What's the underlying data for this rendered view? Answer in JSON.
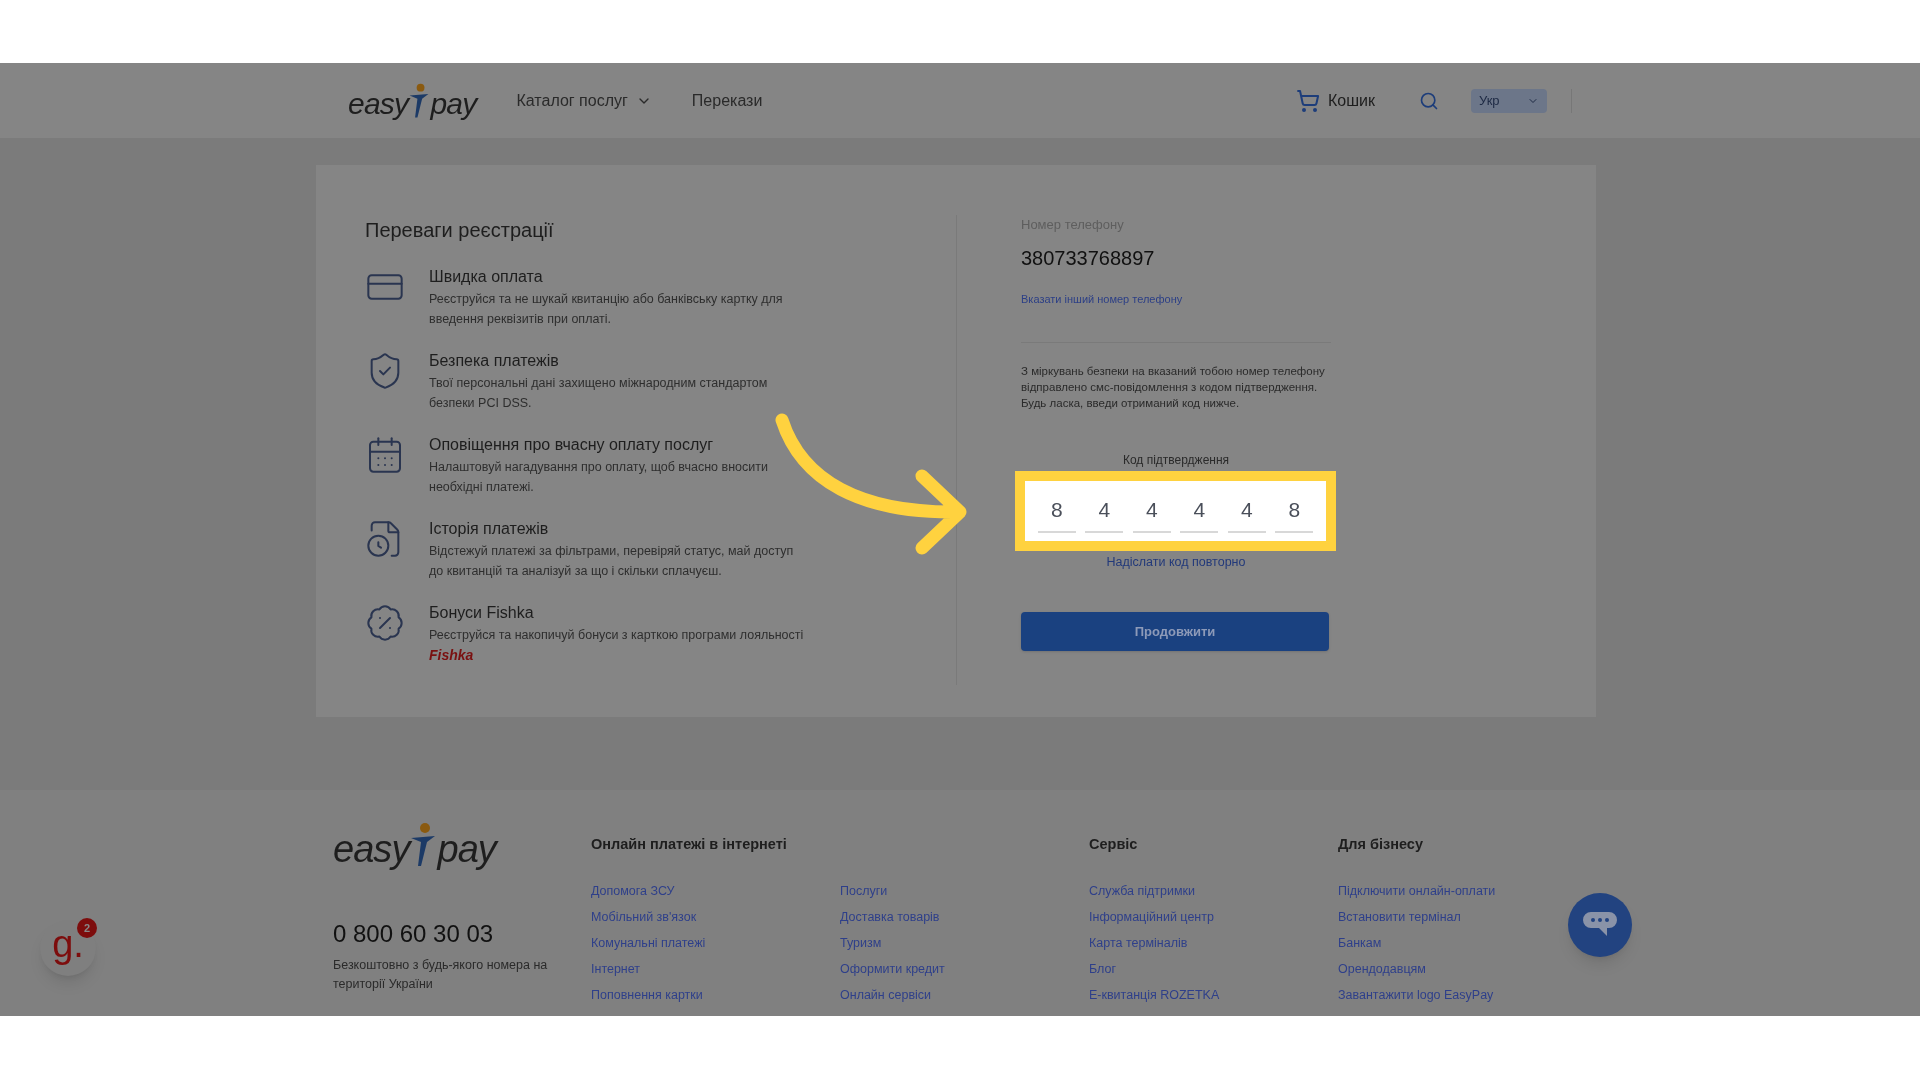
{
  "header": {
    "logo": {
      "left": "easy",
      "right": "pay"
    },
    "nav": [
      {
        "label": "Каталог послуг",
        "kind": "dropdown"
      },
      {
        "label": "Перекази",
        "kind": "link"
      }
    ],
    "cart": "Кошик",
    "language": "Укр"
  },
  "benefits": {
    "title": "Переваги реєстрації",
    "items": [
      {
        "title": "Швидка оплата",
        "text": "Реєструйся та не шукай квитанцію або банківську картку для введення реквізитів при оплаті."
      },
      {
        "title": "Безпека платежів",
        "text": "Твої персональні дані захищено міжнародним стандартом безпеки PCI DSS."
      },
      {
        "title": "Оповіщення про вчасну оплату послуг",
        "text": "Налаштовуй нагадування про оплату, щоб вчасно вносити необхідні платежі."
      },
      {
        "title": "Історія платежів",
        "text": "Відстежуй платежі за фільтрами, перевіряй статус, май доступ до квитанцій та аналізуй за що і скільки сплачуєш."
      },
      {
        "title": "Бонуси Fishka",
        "text": "Реєструйся та накопичуй бонуси з карткою програми лояльності",
        "brand": "Fishka"
      }
    ]
  },
  "form": {
    "phone_label": "Номер телефону",
    "phone": "380733768897",
    "change_link": "Вказати інший номер телефону",
    "notice": "З міркувань безпеки на вказаний тобою номер телефону відправлено смс-повідомлення з кодом підтвердження. Будь ласка, введи отриманий код нижче.",
    "code_label": "Код підтвердження",
    "code_digits": [
      "8",
      "4",
      "4",
      "4",
      "4",
      "8"
    ],
    "resend": "Надіслати код повторно",
    "submit": "Продовжити"
  },
  "footer": {
    "logo": {
      "left": "easy",
      "right": "pay"
    },
    "phone": "0 800 60 30 03",
    "phone_note": "Безкоштовно з будь-якого номера на території України",
    "sections": [
      {
        "heading": "Онлайн платежі в інтернеті",
        "columns": [
          [
            "Допомога ЗСУ",
            "Мобільний зв'язок",
            "Комунальні платежі",
            "Інтернет",
            "Поповнення картки"
          ],
          [
            "Послуги",
            "Доставка товарів",
            "Туризм",
            "Оформити кредит",
            "Онлайн сервіси"
          ]
        ]
      },
      {
        "heading": "Сервіс",
        "columns": [
          [
            "Служба підтримки",
            "Інформаційний центр",
            "Карта терміналів",
            "Блог",
            "Е-квитанція ROZETKA"
          ]
        ]
      },
      {
        "heading": "Для бізнесу",
        "columns": [
          [
            "Підключити онлайн-оплати",
            "Встановити термінал",
            "Банкам",
            "Орендодавцям",
            "Завантажити logo EasyPay"
          ]
        ]
      }
    ]
  },
  "widget": {
    "badge": "2",
    "letter": "g."
  }
}
